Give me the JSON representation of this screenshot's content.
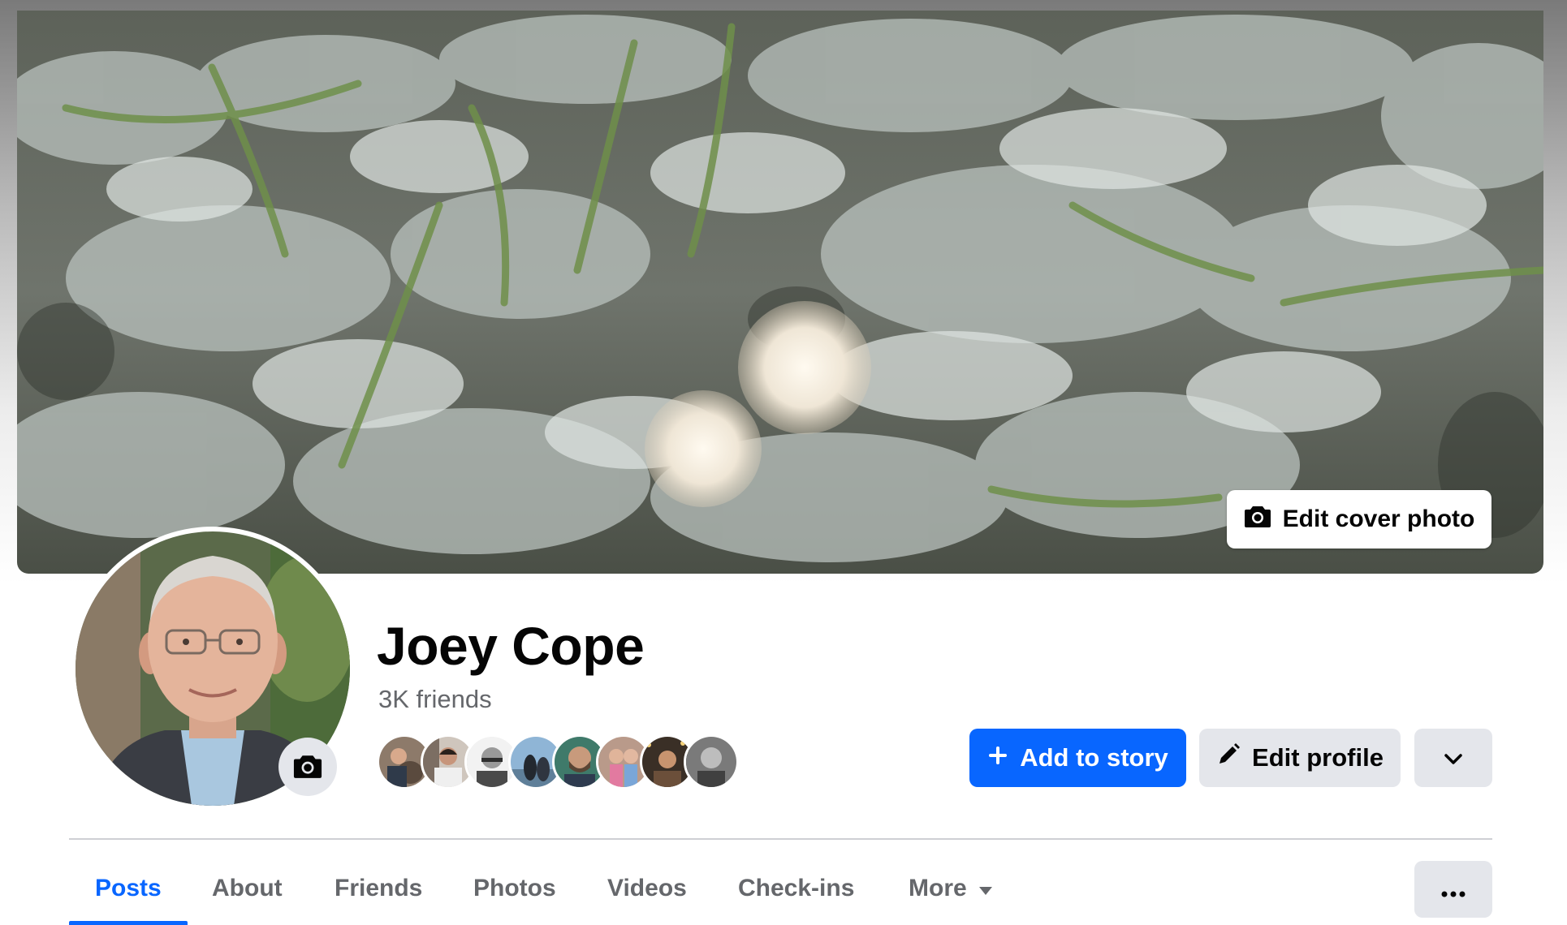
{
  "cover": {
    "edit_label": "Edit cover photo",
    "camera_icon": "camera-icon"
  },
  "profile": {
    "name": "Joey Cope",
    "friends_count": "3K friends",
    "avatar_camera_icon": "camera-icon"
  },
  "friend_avatars": [
    {
      "name": "friend-avatar-1"
    },
    {
      "name": "friend-avatar-2"
    },
    {
      "name": "friend-avatar-3"
    },
    {
      "name": "friend-avatar-4"
    },
    {
      "name": "friend-avatar-5"
    },
    {
      "name": "friend-avatar-6"
    },
    {
      "name": "friend-avatar-7"
    },
    {
      "name": "friend-avatar-8"
    }
  ],
  "actions": {
    "add_story_label": "Add to story",
    "add_story_icon": "plus-icon",
    "edit_profile_label": "Edit profile",
    "edit_profile_icon": "pencil-icon",
    "more_icon": "chevron-down-icon"
  },
  "tabs": [
    {
      "label": "Posts",
      "active": true
    },
    {
      "label": "About",
      "active": false
    },
    {
      "label": "Friends",
      "active": false
    },
    {
      "label": "Photos",
      "active": false
    },
    {
      "label": "Videos",
      "active": false
    },
    {
      "label": "Check-ins",
      "active": false
    },
    {
      "label": "More",
      "active": false,
      "caret_icon": "caret-down-icon"
    }
  ],
  "tab_options_icon": "ellipsis-icon",
  "colors": {
    "accent": "#0866ff",
    "secondary_button": "#e4e6eb",
    "secondary_text": "#65676b",
    "divider": "#ced0d4"
  }
}
